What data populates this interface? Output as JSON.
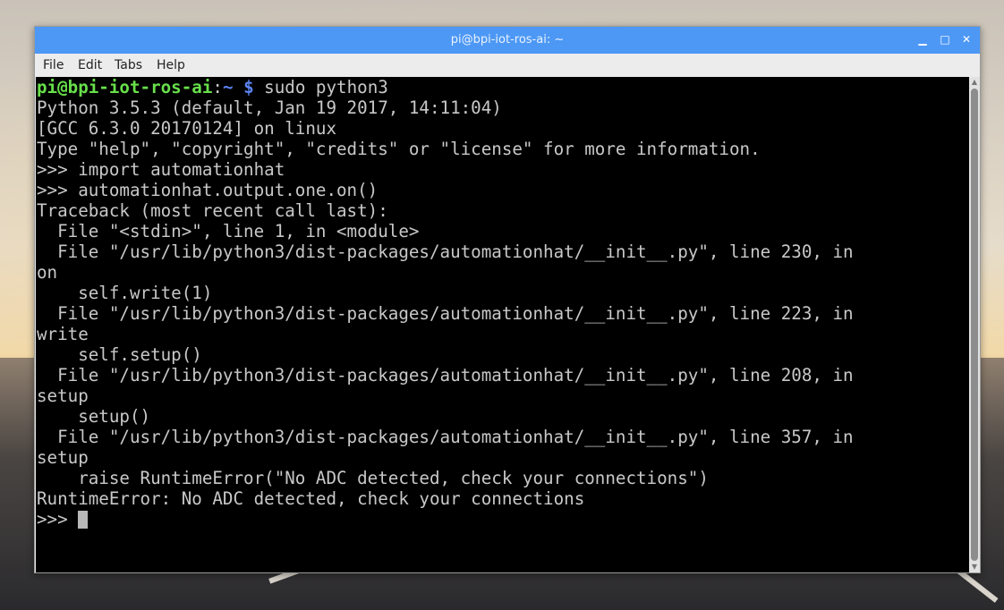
{
  "window": {
    "title": "pi@bpi-iot-ros-ai: ~",
    "minimize_glyph": "▁",
    "maximize_glyph": "□",
    "close_glyph": "✕"
  },
  "menu": [
    "File",
    "Edit",
    "Tabs",
    "Help"
  ],
  "terminal": {
    "prompt_user": "pi@bpi-iot-ros-ai",
    "prompt_sep": ":",
    "prompt_path": "~",
    "prompt_dollar": " $",
    "command": " sudo python3",
    "lines": [
      "Python 3.5.3 (default, Jan 19 2017, 14:11:04)",
      "[GCC 6.3.0 20170124] on linux",
      "Type \"help\", \"copyright\", \"credits\" or \"license\" for more information.",
      ">>> import automationhat",
      ">>> automationhat.output.one.on()",
      "Traceback (most recent call last):",
      "  File \"<stdin>\", line 1, in <module>",
      "  File \"/usr/lib/python3/dist-packages/automationhat/__init__.py\", line 230, in",
      "on",
      "    self.write(1)",
      "  File \"/usr/lib/python3/dist-packages/automationhat/__init__.py\", line 223, in",
      "write",
      "    self.setup()",
      "  File \"/usr/lib/python3/dist-packages/automationhat/__init__.py\", line 208, in",
      "setup",
      "    setup()",
      "  File \"/usr/lib/python3/dist-packages/automationhat/__init__.py\", line 357, in",
      "setup",
      "    raise RuntimeError(\"No ADC detected, check your connections\")",
      "RuntimeError: No ADC detected, check your connections"
    ],
    "final_prompt": ">>> "
  },
  "colors": {
    "titlebar": "#4d98f5",
    "terminal_bg": "#000000",
    "terminal_fg": "#c8c8c8",
    "prompt_user": "#68e04b",
    "prompt_path": "#5b84f2"
  },
  "scrollbar": {
    "up_icon": "▲",
    "down_icon": "▼"
  }
}
